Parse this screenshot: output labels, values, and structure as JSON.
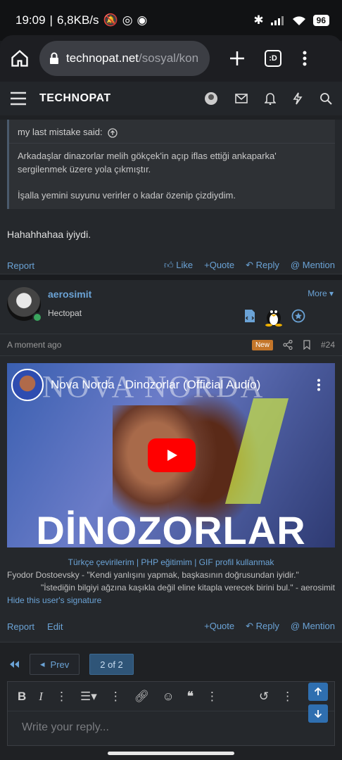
{
  "status_bar": {
    "time": "19:09",
    "speed": "6,8KB/s",
    "battery": "96"
  },
  "browser": {
    "url_host": "technopat.net",
    "url_path": "/sosyal/kon",
    "tab_label": ":D"
  },
  "site_nav": {
    "logo": "TECHNOPAT"
  },
  "post1": {
    "quote_author": "my last mistake said:",
    "quote_line1": "Arkadaşlar dinazorlar melih gökçek'in açıp iflas ettiği ankaparka' sergilenmek üzere yola çıkmıştır.",
    "quote_line2": "İşalla yemini suyunu verirler o kadar özenip çizdiydim.",
    "message": "Hahahhahaa iyiydi.",
    "report": "Report",
    "like": "Like",
    "quote": "Quote",
    "reply": "Reply",
    "mention": "Mention"
  },
  "post2": {
    "username": "aerosimit",
    "rank": "Hectopat",
    "more": "More",
    "time": "A moment ago",
    "new_badge": "New",
    "post_number": "#24",
    "video_title": "Nova Norda - Dinozorlar (Official Audio)",
    "video_bg_text": "NOVA NORDA",
    "video_big_title": "DİNOZORLAR",
    "sig_links": "Türkçe çevirilerim | PHP eğitimim | GIF profil kullanmak",
    "sig_quote1": "Fyodor Dostoevsky - \"Kendi yanlışını yapmak, başkasının doğrusundan iyidir.\"",
    "sig_quote2": "\"İstediğin bilgiyi ağzına kaşıkla değil eline kitapla verecek birini bul.\" - aerosimit",
    "hide_sig": "Hide this user's signature",
    "report": "Report",
    "edit": "Edit",
    "quote": "Quote",
    "reply": "Reply",
    "mention": "Mention"
  },
  "pager": {
    "prev": "Prev",
    "current": "2 of 2"
  },
  "editor": {
    "placeholder": "Write your reply..."
  }
}
